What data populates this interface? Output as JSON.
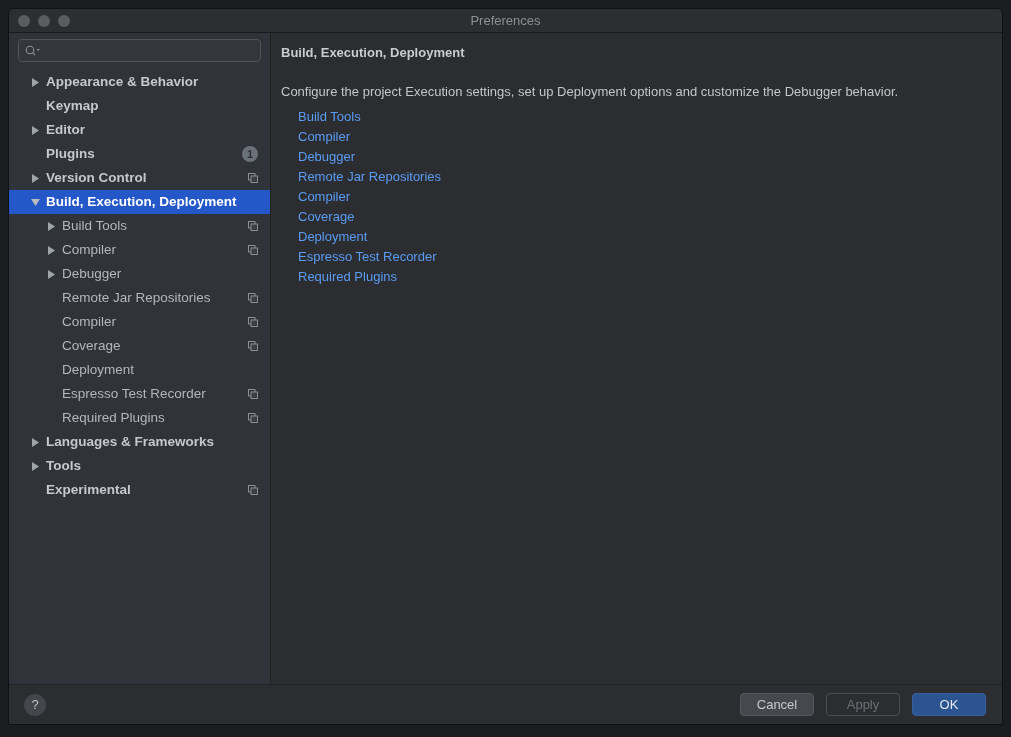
{
  "window": {
    "title": "Preferences"
  },
  "sidebar": {
    "items": [
      {
        "label": "Appearance & Behavior",
        "kind": "group",
        "expanded": false,
        "selected": false,
        "project_scoped": false
      },
      {
        "label": "Keymap",
        "kind": "page",
        "selected": false,
        "project_scoped": false
      },
      {
        "label": "Editor",
        "kind": "group",
        "expanded": false,
        "selected": false,
        "project_scoped": false
      },
      {
        "label": "Plugins",
        "kind": "page",
        "selected": false,
        "project_scoped": false,
        "badge": "1"
      },
      {
        "label": "Version Control",
        "kind": "group",
        "expanded": false,
        "selected": false,
        "project_scoped": true
      },
      {
        "label": "Build, Execution, Deployment",
        "kind": "group",
        "expanded": true,
        "selected": true,
        "project_scoped": false,
        "children": [
          {
            "label": "Build Tools",
            "kind": "group",
            "expanded": false,
            "selected": false,
            "project_scoped": true
          },
          {
            "label": "Compiler",
            "kind": "group",
            "expanded": false,
            "selected": false,
            "project_scoped": true
          },
          {
            "label": "Debugger",
            "kind": "group",
            "expanded": false,
            "selected": false,
            "project_scoped": false
          },
          {
            "label": "Remote Jar Repositories",
            "kind": "page",
            "selected": false,
            "project_scoped": true
          },
          {
            "label": "Compiler",
            "kind": "page",
            "selected": false,
            "project_scoped": true
          },
          {
            "label": "Coverage",
            "kind": "page",
            "selected": false,
            "project_scoped": true
          },
          {
            "label": "Deployment",
            "kind": "page",
            "selected": false,
            "project_scoped": false
          },
          {
            "label": "Espresso Test Recorder",
            "kind": "page",
            "selected": false,
            "project_scoped": true
          },
          {
            "label": "Required Plugins",
            "kind": "page",
            "selected": false,
            "project_scoped": true
          }
        ]
      },
      {
        "label": "Languages & Frameworks",
        "kind": "group",
        "expanded": false,
        "selected": false,
        "project_scoped": false
      },
      {
        "label": "Tools",
        "kind": "group",
        "expanded": false,
        "selected": false,
        "project_scoped": false
      },
      {
        "label": "Experimental",
        "kind": "page",
        "selected": false,
        "project_scoped": true
      }
    ]
  },
  "content": {
    "heading": "Build, Execution, Deployment",
    "description": "Configure the project Execution settings, set up Deployment options and customize the Debugger behavior.",
    "links": [
      "Build Tools",
      "Compiler",
      "Debugger",
      "Remote Jar Repositories",
      "Compiler",
      "Coverage",
      "Deployment",
      "Espresso Test Recorder",
      "Required Plugins"
    ]
  },
  "buttons": [
    {
      "label": "Cancel",
      "kind": "normal",
      "disabled": false
    },
    {
      "label": "Apply",
      "kind": "normal",
      "disabled": true
    },
    {
      "label": "OK",
      "kind": "default",
      "disabled": false
    }
  ],
  "help": {
    "label": "?"
  }
}
